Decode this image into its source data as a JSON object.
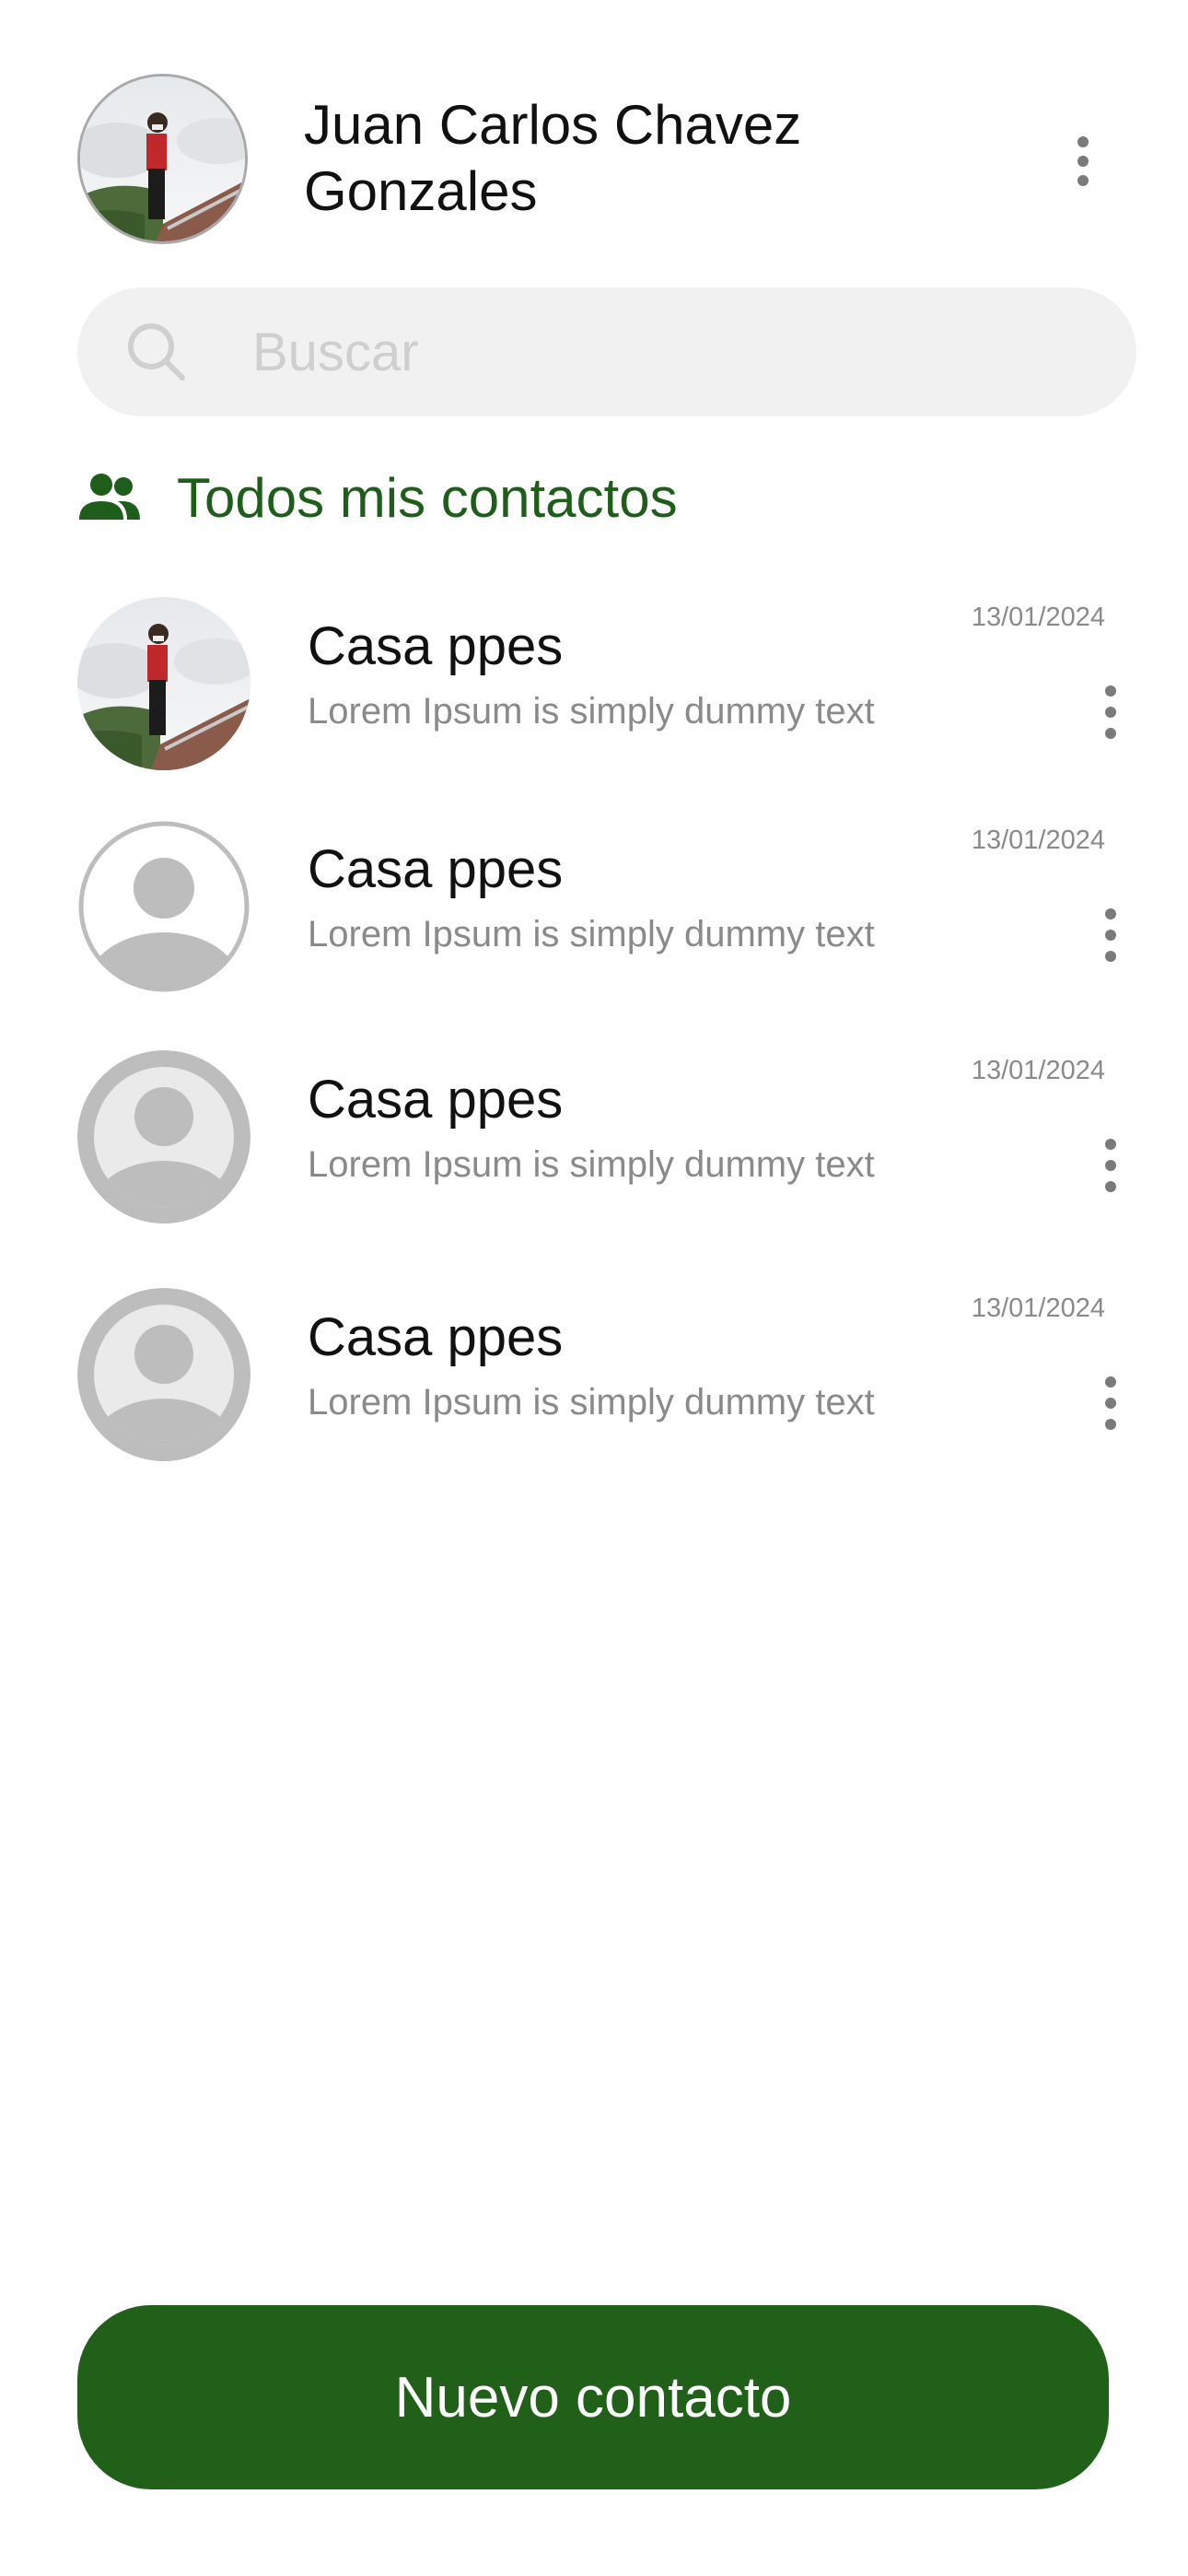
{
  "header": {
    "user_name": "Juan Carlos Chavez Gonzales",
    "avatar": "user-photo",
    "menu_icon": "more-vertical-icon"
  },
  "search": {
    "placeholder": "Buscar",
    "value": "",
    "icon": "search-icon"
  },
  "section": {
    "icon": "people-icon",
    "title": "Todos mis contactos"
  },
  "contacts": [
    {
      "name": "Casa ppes",
      "preview": "Lorem Ipsum is simply dummy text",
      "date": "13/01/2024",
      "avatar": "photo"
    },
    {
      "name": "Casa ppes",
      "preview": "Lorem Ipsum is simply dummy text",
      "date": "13/01/2024",
      "avatar": "placeholder-outline"
    },
    {
      "name": "Casa ppes",
      "preview": "Lorem Ipsum is simply dummy text",
      "date": "13/01/2024",
      "avatar": "placeholder-filled"
    },
    {
      "name": "Casa ppes",
      "preview": "Lorem Ipsum is simply dummy text",
      "date": "13/01/2024",
      "avatar": "placeholder-filled"
    }
  ],
  "actions": {
    "new_contact": "Nuevo contacto"
  },
  "colors": {
    "accent": "#206019",
    "section_title": "#1e5e1a",
    "muted_text": "#8a8a8a",
    "search_bg": "#f1f1f1",
    "avatar_gray": "#bdbdbd"
  }
}
